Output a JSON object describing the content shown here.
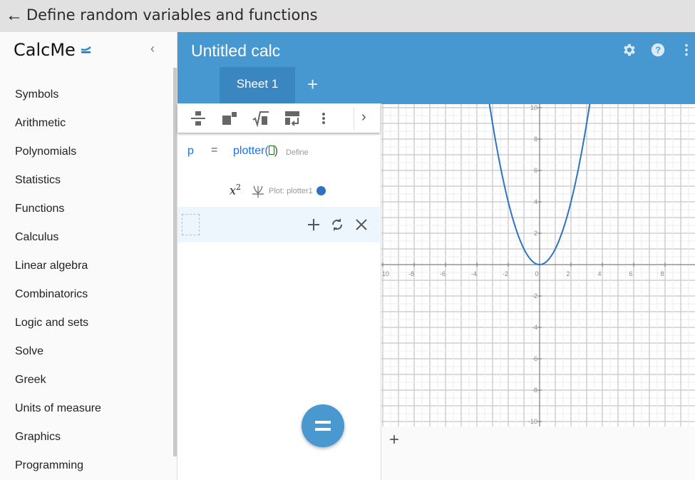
{
  "topbar": {
    "back_icon": "arrow-left-icon",
    "title": "Define random variables and functions"
  },
  "sidebar": {
    "logo": "CalcMe",
    "collapse_icon": "chevron-left-icon",
    "items": [
      {
        "label": "Symbols"
      },
      {
        "label": "Arithmetic"
      },
      {
        "label": "Polynomials"
      },
      {
        "label": "Statistics"
      },
      {
        "label": "Functions"
      },
      {
        "label": "Calculus"
      },
      {
        "label": "Linear algebra"
      },
      {
        "label": "Combinatorics"
      },
      {
        "label": "Logic and sets"
      },
      {
        "label": "Solve"
      },
      {
        "label": "Greek"
      },
      {
        "label": "Units of measure"
      },
      {
        "label": "Graphics"
      },
      {
        "label": "Programming"
      }
    ]
  },
  "header": {
    "title": "Untitled calc",
    "icons": [
      "gear-icon",
      "help-icon",
      "more-vertical-icon"
    ],
    "tabs": [
      {
        "label": "Sheet 1"
      }
    ],
    "add_tab": "+"
  },
  "toolbar": {
    "icons": [
      "fraction-icon",
      "superscript-icon",
      "square-root-icon",
      "matrix-icon",
      "more-vertical-icon",
      "chevron-right-icon"
    ]
  },
  "editor": {
    "rows": [
      {
        "variable": "p",
        "operator": "=",
        "function": "plotter(",
        "close": ")",
        "hint": "Define"
      },
      {
        "expression_base": "x",
        "expression_exp": "2",
        "plot_label": "Plot: plotter1",
        "plot_color": "#2f73c0"
      }
    ],
    "actions": [
      "plus-icon",
      "refresh-icon",
      "close-icon"
    ],
    "evaluate_label": "="
  },
  "plot_area": {
    "add_label": "+"
  },
  "colors": {
    "accent": "#4797d0",
    "tab_active": "#3a86c0",
    "curve": "#2f73c0"
  },
  "chart_data": {
    "type": "line",
    "function": "x^2",
    "xlim": [
      -10,
      10
    ],
    "ylim": [
      -10,
      10
    ],
    "x_ticks": [
      "10",
      "-8",
      "-6",
      "-4",
      "-2",
      "0",
      "2",
      "4",
      "6",
      "8"
    ],
    "y_ticks": [
      "10",
      "8",
      "6",
      "4",
      "2",
      "-2",
      "-4",
      "-6",
      "-8",
      "-10"
    ],
    "grid": true,
    "series": [
      {
        "x": [
          -3.2,
          -3,
          -2.5,
          -2,
          -1.5,
          -1,
          -0.5,
          0,
          0.5,
          1,
          1.5,
          2,
          2.5,
          3,
          3.2
        ],
        "y": [
          10.24,
          9,
          6.25,
          4,
          2.25,
          1,
          0.25,
          0,
          0.25,
          1,
          2.25,
          4,
          6.25,
          9,
          10.24
        ]
      }
    ]
  }
}
